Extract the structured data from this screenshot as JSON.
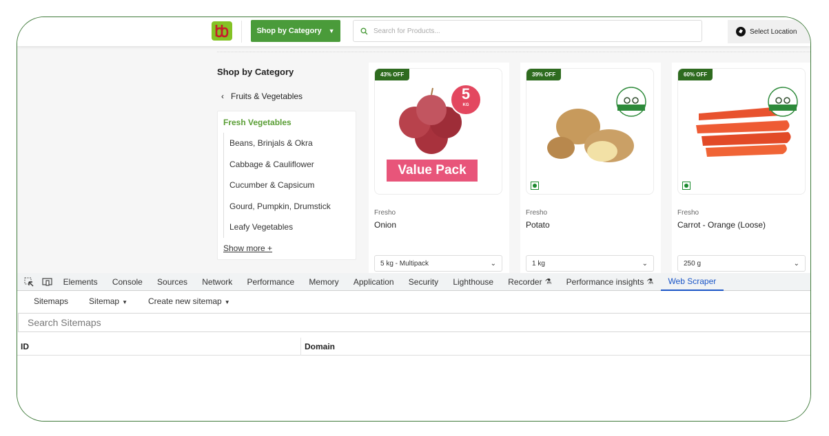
{
  "header": {
    "logo_text": "bb",
    "shop_button_label": "Shop by Category",
    "search_placeholder": "Search for Products...",
    "location_label": "Select Location"
  },
  "sidebar": {
    "title": "Shop by Category",
    "back_label": "Fruits & Vegetables",
    "active_category": "Fresh Vegetables",
    "items": [
      {
        "label": "Beans, Brinjals & Okra"
      },
      {
        "label": "Cabbage & Cauliflower"
      },
      {
        "label": "Cucumber & Capsicum"
      },
      {
        "label": "Gourd, Pumpkin, Drumstick"
      },
      {
        "label": "Leafy Vegetables"
      }
    ],
    "show_more_label": "Show more +"
  },
  "products": [
    {
      "discount": "43% OFF",
      "brand": "Fresho",
      "name": "Onion",
      "pack": "5 kg - Multipack",
      "badge_number": "5",
      "badge_unit": "KG",
      "overlay_text": "Value Pack"
    },
    {
      "discount": "39% OFF",
      "brand": "Fresho",
      "name": "Potato",
      "pack": "1 kg"
    },
    {
      "discount": "60% OFF",
      "brand": "Fresho",
      "name": "Carrot - Orange (Loose)",
      "pack": "250 g"
    }
  ],
  "devtools": {
    "tabs": [
      {
        "label": "Elements"
      },
      {
        "label": "Console"
      },
      {
        "label": "Sources"
      },
      {
        "label": "Network"
      },
      {
        "label": "Performance"
      },
      {
        "label": "Memory"
      },
      {
        "label": "Application"
      },
      {
        "label": "Security"
      },
      {
        "label": "Lighthouse"
      },
      {
        "label": "Recorder"
      },
      {
        "label": "Performance insights"
      },
      {
        "label": "Web Scraper"
      }
    ],
    "active_tab": "Web Scraper"
  },
  "web_scraper": {
    "toolbar": {
      "sitemaps": "Sitemaps",
      "sitemap": "Sitemap",
      "create": "Create new sitemap"
    },
    "search_placeholder": "Search Sitemaps",
    "columns": {
      "id": "ID",
      "domain": "Domain"
    }
  },
  "colors": {
    "brand_green": "#4a9b3a",
    "discount_green": "#2e6b1f",
    "active_tab_blue": "#1a55c7",
    "value_pack_pink": "#e8557a",
    "frame_border": "#3f7a3a"
  }
}
